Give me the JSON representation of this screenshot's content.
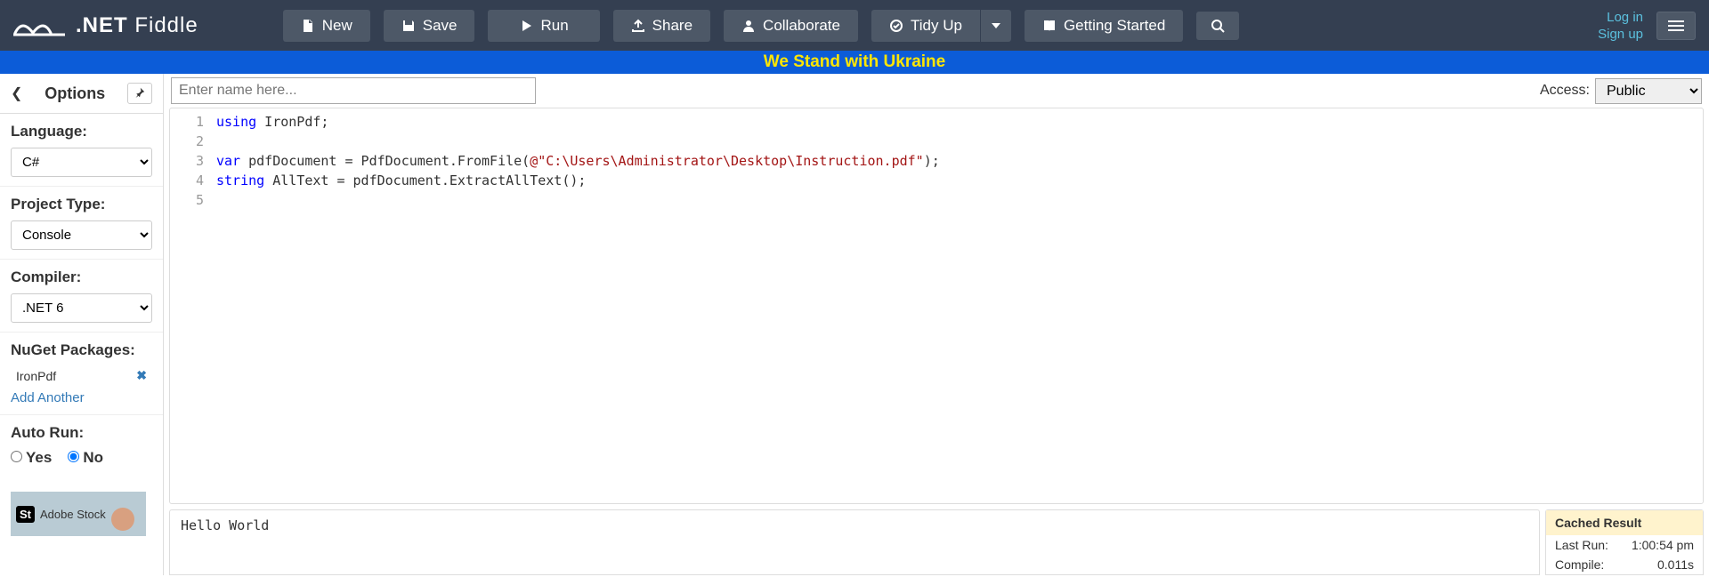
{
  "logo": {
    "name": ".NET",
    "suffix": "Fiddle"
  },
  "toolbar": {
    "new": "New",
    "save": "Save",
    "run": "Run",
    "share": "Share",
    "collaborate": "Collaborate",
    "tidy": "Tidy Up",
    "getting_started": "Getting Started"
  },
  "auth": {
    "login": "Log in",
    "signup": "Sign up"
  },
  "banner": "We Stand with Ukraine",
  "sidebar": {
    "title": "Options",
    "language_label": "Language:",
    "language_value": "C#",
    "project_label": "Project Type:",
    "project_value": "Console",
    "compiler_label": "Compiler:",
    "compiler_value": ".NET 6",
    "nuget_label": "NuGet Packages:",
    "nuget_items": [
      {
        "name": "IronPdf"
      }
    ],
    "add_another": "Add Another",
    "autorun_label": "Auto Run:",
    "autorun_yes": "Yes",
    "autorun_no": "No",
    "ad_text": "Adobe Stock"
  },
  "name_placeholder": "Enter name here...",
  "access_label": "Access:",
  "access_value": "Public",
  "code": {
    "lines": [
      "1",
      "2",
      "3",
      "4",
      "5"
    ],
    "l1_kw": "using",
    "l1_rest": " IronPdf;",
    "l3_kw": "var",
    "l3_a": " pdfDocument = PdfDocument.FromFile(",
    "l3_str": "@\"C:\\Users\\Administrator\\Desktop\\Instruction.pdf\"",
    "l3_b": ");",
    "l4_kw": "string",
    "l4_rest": " AllText = pdfDocument.ExtractAllText();"
  },
  "output": "Hello World",
  "result": {
    "header": "Cached Result",
    "last_run_label": "Last Run:",
    "last_run_value": "1:00:54 pm",
    "compile_label": "Compile:",
    "compile_value": "0.011s"
  }
}
